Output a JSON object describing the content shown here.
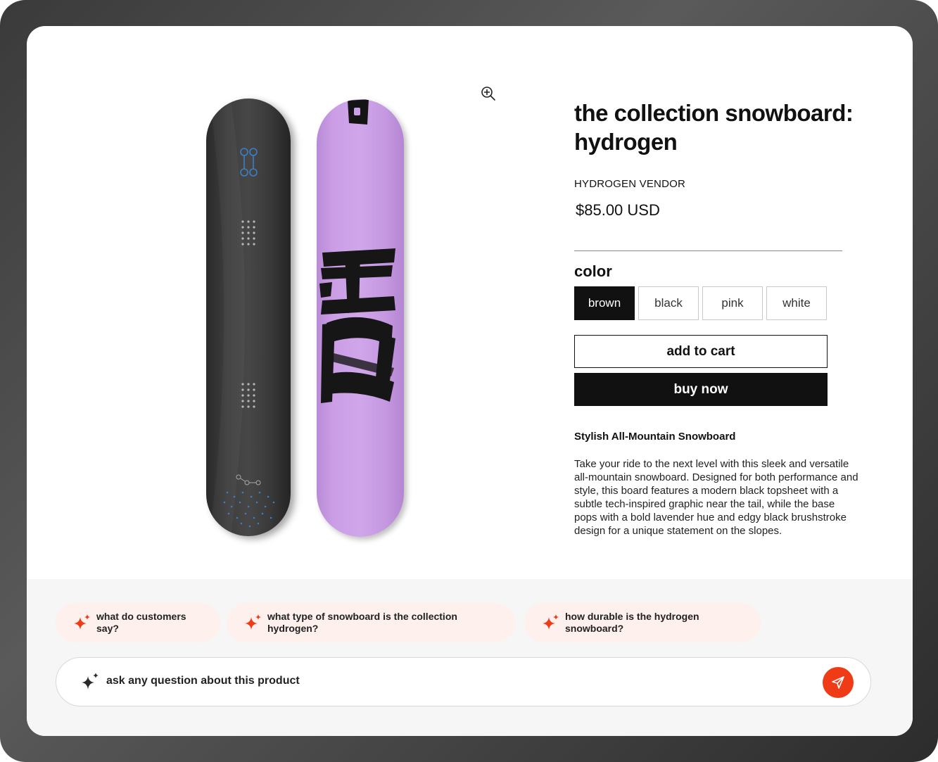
{
  "product": {
    "title": "the collection snowboard: hydrogen",
    "vendor": "HYDROGEN VENDOR",
    "price": "$85.00 USD",
    "color_label": "color",
    "colors": [
      {
        "label": "brown",
        "selected": true
      },
      {
        "label": "black",
        "selected": false
      },
      {
        "label": "pink",
        "selected": false
      },
      {
        "label": "white",
        "selected": false
      }
    ],
    "add_to_cart_label": "add to cart",
    "buy_now_label": "buy now",
    "description_title": "Stylish All-Mountain Snowboard",
    "description": "Take your ride to the next level with this sleek and versatile all-mountain snowboard. Designed for both performance and style, this board features a modern black topsheet with a subtle tech-inspired graphic near the tail, while the base pops with a bold lavender hue and edgy black brushstroke design for a unique statement on the slopes.",
    "image_icons": [
      "zoom-in-icon"
    ]
  },
  "assistant": {
    "suggestions": [
      "what do customers say?",
      "what type of snowboard is the collection hydrogen?",
      "how durable is the hydrogen snowboard?"
    ],
    "input_placeholder": "ask any question about this product",
    "icons": [
      "sparkle-icon",
      "send-icon"
    ]
  },
  "colors": {
    "accent": "#ef3b16",
    "chip_background": "#fdf0ed",
    "board_base": "#cc9fe6",
    "board_top": "#3a3a3a",
    "primary_button": "#111111"
  }
}
